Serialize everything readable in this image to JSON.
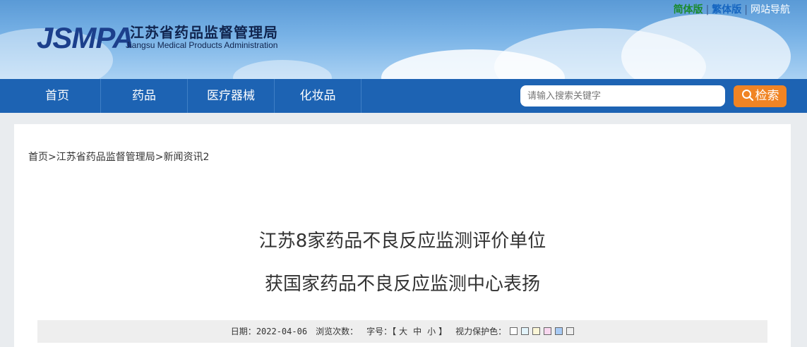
{
  "header": {
    "logo": "JSMPA",
    "org_name_cn": "江苏省药品监督管理局",
    "org_name_en": "Jiangsu Medical Products Administration",
    "lang": {
      "simplified": "简体版",
      "traditional": "繁体版",
      "site_nav": "网站导航",
      "sep": "|"
    }
  },
  "nav": {
    "items": [
      {
        "label": "首页"
      },
      {
        "label": "药品"
      },
      {
        "label": "医疗器械"
      },
      {
        "label": "化妆品"
      }
    ],
    "search_placeholder": "请输入搜索关键字",
    "search_button": "检索"
  },
  "breadcrumb": {
    "items": [
      "首页",
      "江苏省药品监督管理局",
      "新闻资讯2"
    ],
    "sep": ">"
  },
  "article": {
    "title_line1": "江苏8家药品不良反应监测评价单位",
    "title_line2": "获国家药品不良反应监测中心表扬",
    "meta": {
      "date_label": "日期：",
      "date": "2022-04-06",
      "views_label": "浏览次数：",
      "font_label": "字号：",
      "bracket_open": "【",
      "bracket_close": "】",
      "size_large": "大",
      "size_medium": "中",
      "size_small": "小",
      "eye_label": "视力保护色：",
      "swatch_colors": [
        "#ffffff",
        "#e3f4fb",
        "#fbf6d7",
        "#f9d8f0",
        "#a9cbf5",
        "#eeeeee"
      ]
    }
  },
  "colors": {
    "nav_bg": "#1d63b3",
    "search_button_bg": "#f08424",
    "logo_color": "#1c3f8c"
  }
}
